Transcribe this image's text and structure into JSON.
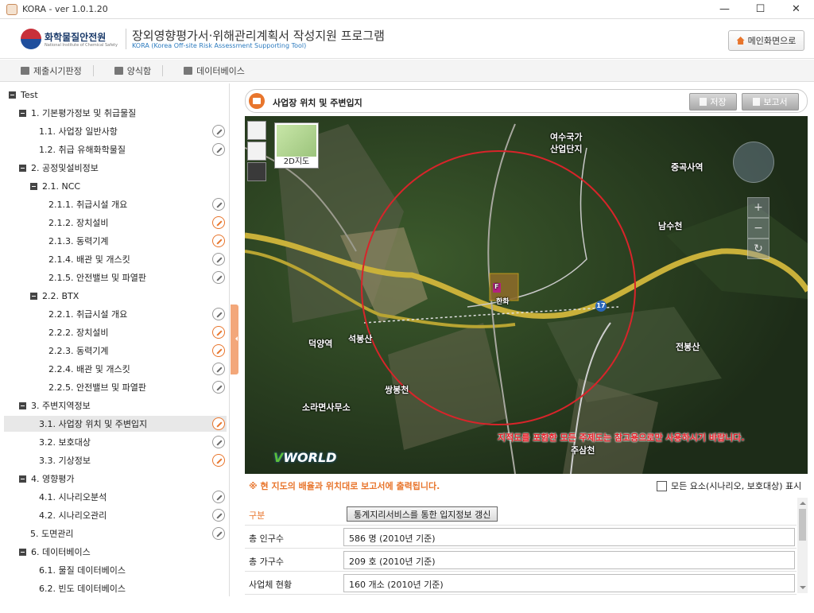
{
  "window": {
    "title": "KORA - ver 1.0.1.20",
    "minimize": "—",
    "maximize": "☐",
    "close": "✕"
  },
  "header": {
    "org_name": "화학물질안전원",
    "org_sub": "National Institute of Chemical Safety",
    "app_title": "장외영향평가서·위해관리계획서 작성지원 프로그램",
    "app_subtitle": "KORA (Korea Off-site Risk Assessment Supporting Tool)",
    "main_button": "메인화면으로"
  },
  "toolbar": {
    "items": [
      "제출시기판정",
      "양식함",
      "데이터베이스"
    ]
  },
  "sidebar": {
    "items": [
      {
        "label": "Test",
        "level": 0,
        "expander": true
      },
      {
        "label": "1. 기본평가정보 및 취급물질",
        "level": 1,
        "expander": true
      },
      {
        "label": "1.1. 사업장 일반사항",
        "level": 3,
        "pen": "gray"
      },
      {
        "label": "1.2. 취급 유해화학물질",
        "level": 3,
        "pen": "gray"
      },
      {
        "label": "2. 공정및설비정보",
        "level": 1,
        "expander": true
      },
      {
        "label": "2.1. NCC",
        "level": 2,
        "expander": true
      },
      {
        "label": "2.1.1. 취급시설 개요",
        "level": 4,
        "pen": "gray"
      },
      {
        "label": "2.1.2. 장치설비",
        "level": 4,
        "pen": "orange"
      },
      {
        "label": "2.1.3. 동력기계",
        "level": 4,
        "pen": "orange"
      },
      {
        "label": "2.1.4. 배관 및 개스킷",
        "level": 4,
        "pen": "gray"
      },
      {
        "label": "2.1.5. 안전밸브 및 파열판",
        "level": 4,
        "pen": "gray"
      },
      {
        "label": "2.2. BTX",
        "level": 2,
        "expander": true
      },
      {
        "label": "2.2.1. 취급시설 개요",
        "level": 4,
        "pen": "gray"
      },
      {
        "label": "2.2.2. 장치설비",
        "level": 4,
        "pen": "orange"
      },
      {
        "label": "2.2.3. 동력기계",
        "level": 4,
        "pen": "orange"
      },
      {
        "label": "2.2.4. 배관 및 개스킷",
        "level": 4,
        "pen": "gray"
      },
      {
        "label": "2.2.5. 안전밸브 및 파열판",
        "level": 4,
        "pen": "gray"
      },
      {
        "label": "3. 주변지역정보",
        "level": 1,
        "expander": true
      },
      {
        "label": "3.1. 사업장 위치 및 주변입지",
        "level": 3,
        "pen": "orange",
        "selected": true
      },
      {
        "label": "3.2. 보호대상",
        "level": 3,
        "pen": "gray"
      },
      {
        "label": "3.3. 기상정보",
        "level": 3,
        "pen": "orange"
      },
      {
        "label": "4. 영향평가",
        "level": 1,
        "expander": true
      },
      {
        "label": "4.1. 시나리오분석",
        "level": 3,
        "pen": "gray"
      },
      {
        "label": "4.2. 시나리오관리",
        "level": 3,
        "pen": "gray"
      },
      {
        "label": "5. 도면관리",
        "level": 2,
        "pen": "gray"
      },
      {
        "label": "6. 데이터베이스",
        "level": 1,
        "expander": true
      },
      {
        "label": "6.1. 물질 데이터베이스",
        "level": 3
      },
      {
        "label": "6.2. 빈도 데이터베이스",
        "level": 3
      }
    ]
  },
  "panel": {
    "title": "사업장 위치 및 주변입지",
    "save": "저장",
    "report": "보고서"
  },
  "map": {
    "minimap_label": "2D지도",
    "labels": [
      {
        "text": "여수국가",
        "id": "l1"
      },
      {
        "text": "산업단지",
        "id": "l2"
      },
      {
        "text": "중곡사역",
        "id": "l3"
      },
      {
        "text": "남수천",
        "id": "l4"
      },
      {
        "text": "전봉산",
        "id": "l5"
      },
      {
        "text": "덕양역",
        "id": "l6"
      },
      {
        "text": "석봉산",
        "id": "l7"
      },
      {
        "text": "쌍봉천",
        "id": "l8"
      },
      {
        "text": "소라면사무소",
        "id": "l9"
      },
      {
        "text": "주삼천",
        "id": "l10"
      }
    ],
    "site_label": "F",
    "site_name": "한화",
    "route": "17",
    "disclaimer": "지적도를 포함한 모든 주제도는 참고용으로만 사용하시기 바랍니다.",
    "brand": "VWORLD"
  },
  "notice": "※ 현 지도의 배율과 위치대로 보고서에 출력됩니다.",
  "checkbox_label": "모든 요소(시나리오, 보호대상) 표시",
  "table": {
    "header_label": "구분",
    "update_button": "통계지리서비스를 통한 입지정보 갱신",
    "rows": [
      {
        "label": "총 인구수",
        "value": "586 명 (2010년 기준)"
      },
      {
        "label": "총 가구수",
        "value": "209 호 (2010년 기준)"
      },
      {
        "label": "사업체 현황",
        "value": "160 개소 (2010년 기준)"
      }
    ]
  },
  "colors": {
    "accent": "#e8752c",
    "warning": "#e8212a",
    "circle": "#d8242a"
  }
}
